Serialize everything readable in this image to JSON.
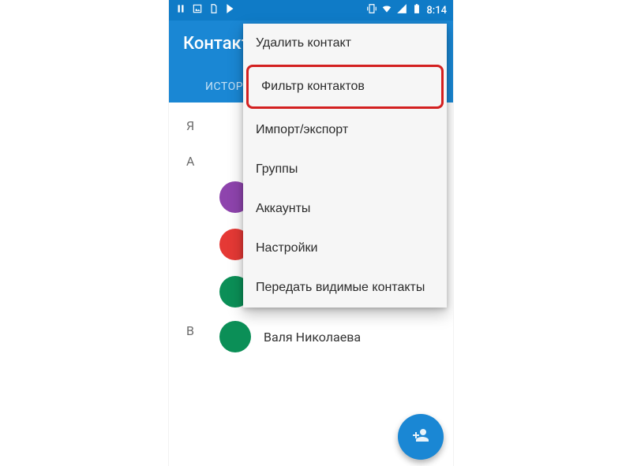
{
  "status_bar": {
    "time": "8:14"
  },
  "app_bar": {
    "title": "Контакты"
  },
  "tab_bar": {
    "history_tab_label": "История"
  },
  "menu": {
    "items": [
      {
        "label": "Удалить контакт"
      },
      {
        "label": "Фильтр контактов"
      },
      {
        "label": "Импорт/экспорт"
      },
      {
        "label": "Группы"
      },
      {
        "label": "Аккаунты"
      },
      {
        "label": "Настройки"
      },
      {
        "label": "Передать видимые контакты"
      }
    ],
    "highlighted_index": 1
  },
  "contacts": {
    "sections": [
      {
        "letter": "Я",
        "items": []
      },
      {
        "letter": "А",
        "items": [
          {
            "name_display": " ",
            "avatar_color": "purple",
            "blurred": true
          },
          {
            "name_display": " ",
            "avatar_color": "red",
            "blurred": true
          },
          {
            "name_display": " ",
            "avatar_color": "green",
            "blurred": true
          }
        ]
      },
      {
        "letter": "В",
        "items": [
          {
            "name_display": "Валя Николаева",
            "avatar_color": "green",
            "blurred": false
          }
        ]
      }
    ]
  }
}
